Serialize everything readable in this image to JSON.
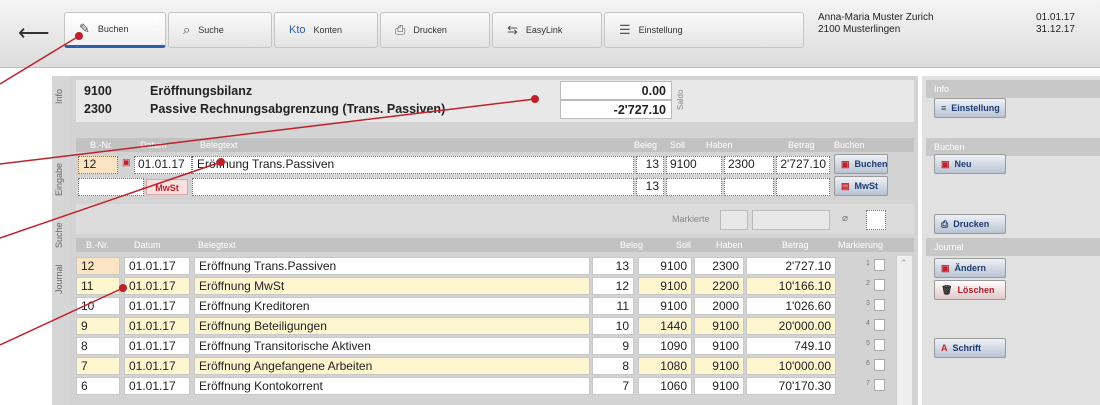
{
  "toolbar": {
    "tabs": [
      {
        "label": "Buchen",
        "badge": "1"
      },
      {
        "label": "Suche"
      },
      {
        "label": "Konten",
        "prefix": "Kto"
      },
      {
        "label": "Drucken"
      },
      {
        "label": "EasyLink"
      },
      {
        "label": "Einstellung"
      }
    ],
    "company_name": "Anna-Maria Muster Zurich",
    "company_address": "2100 Musterlingen",
    "date_from": "01.01.17",
    "date_to": "31.12.17"
  },
  "side_labels": {
    "info": "Info",
    "eingabe": "Eingabe",
    "suche": "Suche",
    "journal": "Journal"
  },
  "info": {
    "account1": {
      "number": "9100",
      "name": "Eröffnungsbilanz",
      "balance": "0.00"
    },
    "account2": {
      "number": "2300",
      "name": "Passive Rechnungsabgrenzung (Trans. Passiven)",
      "balance": "-2'727.10"
    },
    "saldo_label": "Saldo"
  },
  "entry": {
    "headers": {
      "bnr": "B.-Nr.",
      "datum": "Datum",
      "belegtext": "Belegtext",
      "beleg": "Beleg",
      "soll": "Soll",
      "haben": "Haben",
      "betrag": "Betrag",
      "buchen": "Buchen"
    },
    "row1": {
      "bnr": "12",
      "datum": "01.01.17",
      "belegtext": "Eröffnung Trans.Passiven",
      "beleg": "13",
      "soll": "9100",
      "haben": "2300",
      "betrag": "2'727.10"
    },
    "row2": {
      "mwst_tag": "MwSt",
      "beleg": "13"
    },
    "buchen_button": "Buchen",
    "mwst_button": "MwSt"
  },
  "filter": {
    "markierte_label": "Markierte"
  },
  "journal": {
    "headers": {
      "bnr": "B.-Nr.",
      "datum": "Datum",
      "belegtext": "Belegtext",
      "beleg": "Beleg",
      "soll": "Soll",
      "haben": "Haben",
      "betrag": "Betrag",
      "markierung": "Markierung"
    },
    "rows": [
      {
        "bnr": "12",
        "datum": "01.01.17",
        "text": "Eröffnung Trans.Passiven",
        "beleg": "13",
        "soll": "9100",
        "haben": "2300",
        "betrag": "2'727.10",
        "mark": "1"
      },
      {
        "bnr": "11",
        "datum": "01.01.17",
        "text": "Eröffnung MwSt",
        "beleg": "12",
        "soll": "9100",
        "haben": "2200",
        "betrag": "10'166.10",
        "mark": "2"
      },
      {
        "bnr": "10",
        "datum": "01.01.17",
        "text": "Eröffnung Kreditoren",
        "beleg": "11",
        "soll": "9100",
        "haben": "2000",
        "betrag": "1'026.60",
        "mark": "3"
      },
      {
        "bnr": "9",
        "datum": "01.01.17",
        "text": "Eröffnung Beteiligungen",
        "beleg": "10",
        "soll": "1440",
        "haben": "9100",
        "betrag": "20'000.00",
        "mark": "4"
      },
      {
        "bnr": "8",
        "datum": "01.01.17",
        "text": "Eröffnung Transitorische Aktiven",
        "beleg": "9",
        "soll": "1090",
        "haben": "9100",
        "betrag": "749.10",
        "mark": "5"
      },
      {
        "bnr": "7",
        "datum": "01.01.17",
        "text": "Eröffnung Angefangene Arbeiten",
        "beleg": "8",
        "soll": "1080",
        "haben": "9100",
        "betrag": "10'000.00",
        "mark": "6"
      },
      {
        "bnr": "6",
        "datum": "01.01.17",
        "text": "Eröffnung Kontokorrent",
        "beleg": "7",
        "soll": "1060",
        "haben": "9100",
        "betrag": "70'170.30",
        "mark": "7"
      }
    ]
  },
  "right_panel": {
    "info_header": "Info",
    "einstellung_button": "Einstellung",
    "buchen_header": "Buchen",
    "neu_button": "Neu",
    "drucken_button": "Drucken",
    "journal_header": "Journal",
    "aendern_button": "Ändern",
    "loeschen_button": "Löschen",
    "schrift_button": "Schrift"
  },
  "colors": {
    "accent": "#2d5ea9",
    "annotation_red": "#c0202b",
    "row_yellow": "#fdf6cf",
    "highlight_orange": "#fbe4c2"
  }
}
